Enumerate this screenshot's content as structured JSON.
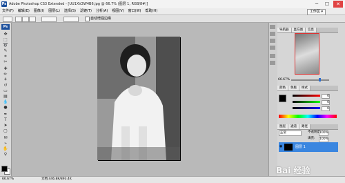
{
  "app": {
    "logo": "Ps",
    "title": "Adobe Photoshop CS3 Extended - [UU1XV2W4B6.jpg @ 66.7% (图层 1, RGB/8#)]"
  },
  "window_buttons": {
    "minimize": "─",
    "maximize": "☐",
    "close": "✕"
  },
  "menu": [
    "文件(F)",
    "编辑(E)",
    "图像(I)",
    "图层(L)",
    "选择(S)",
    "滤镜(T)",
    "分析(A)",
    "视图(V)",
    "窗口(W)",
    "帮助(H)"
  ],
  "workspace": "工作区 ▾",
  "options": {
    "auto_enhance": "自动增强边缘"
  },
  "navigator": {
    "tabs": [
      "导航器",
      "直方图",
      "信息"
    ],
    "zoom": "66.67%"
  },
  "color_panel": {
    "tabs": [
      "颜色",
      "色板",
      "样式"
    ],
    "values": [
      "0",
      "0",
      "0"
    ]
  },
  "layers_panel": {
    "tabs": [
      "图层",
      "通道",
      "路径"
    ],
    "blend_mode": "正常",
    "opacity_label": "不透明度:",
    "opacity": "100%",
    "fill_label": "填充:",
    "fill": "100%",
    "layer_name": "图层 1"
  },
  "status": {
    "zoom": "66.67%",
    "doc": "文档:446.8K/893.4K"
  },
  "watermark": "Bai 经验",
  "colors": {
    "accent": "#3a86e0",
    "close": "#e04343"
  }
}
